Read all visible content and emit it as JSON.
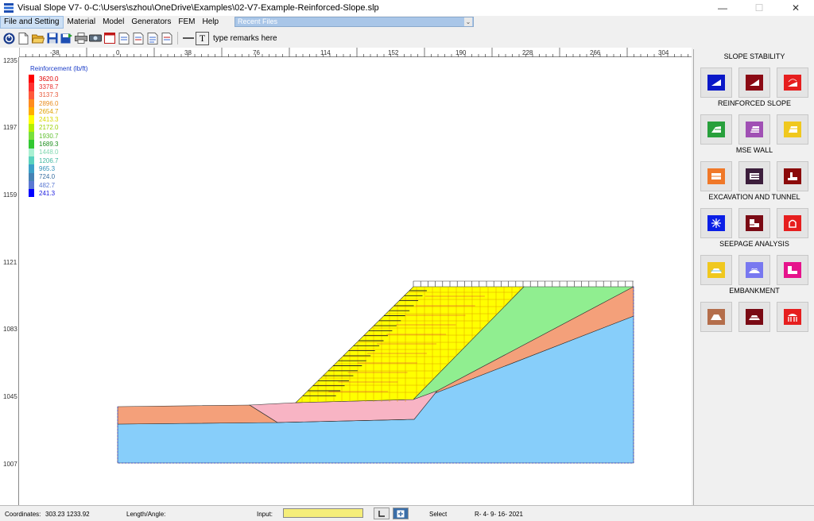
{
  "window": {
    "title": "Visual Slope V7- 0-C:\\Users\\szhou\\OneDrive\\Examples\\02-V7-Example-Reinforced-Slope.slp",
    "controls": [
      "—",
      "☐",
      "✕"
    ]
  },
  "menu": {
    "items": [
      "File and Setting",
      "Material",
      "Model",
      "Generators",
      "FEM",
      "Help"
    ],
    "recent_files": "Recent Files"
  },
  "toolbar": {
    "icons": [
      "power-icon",
      "new-file-icon",
      "open-folder-icon",
      "save-icon",
      "save-as-icon",
      "print-icon",
      "print-preview-icon",
      "window-icon",
      "report-1-icon",
      "report-2-icon",
      "report-3-icon",
      "report-4-icon"
    ],
    "text_tool": "T",
    "remarks": "type remarks here"
  },
  "rulers": {
    "top": [
      "-38",
      "0",
      "38",
      "76",
      "114",
      "152",
      "190",
      "228",
      "266",
      "304"
    ],
    "left": [
      "1235",
      "1197",
      "1159",
      "1121",
      "1083",
      "1045",
      "1007"
    ]
  },
  "legend": {
    "title": "Reinforcement (lb/ft)",
    "items": [
      {
        "value": "3620.0",
        "color": "#ff0000",
        "text_color": "#e00000"
      },
      {
        "value": "3378.7",
        "color": "#ff3030",
        "text_color": "#e83030"
      },
      {
        "value": "3137.3",
        "color": "#ff5a3c",
        "text_color": "#e85a3c"
      },
      {
        "value": "2896.0",
        "color": "#ff8c1e",
        "text_color": "#e88c1e"
      },
      {
        "value": "2654.7",
        "color": "#ffae00",
        "text_color": "#e0a000"
      },
      {
        "value": "2413.3",
        "color": "#ffff00",
        "text_color": "#d8d800"
      },
      {
        "value": "2172.0",
        "color": "#b4f000",
        "text_color": "#9ad000"
      },
      {
        "value": "1930.7",
        "color": "#78e03c",
        "text_color": "#60c030"
      },
      {
        "value": "1689.3",
        "color": "#32c832",
        "text_color": "#209020"
      },
      {
        "value": "1448.0",
        "color": "#aaf0d2",
        "text_color": "#80d8b0"
      },
      {
        "value": "1206.7",
        "color": "#5ad2be",
        "text_color": "#40b8a0"
      },
      {
        "value": "965.3",
        "color": "#3ca0c8",
        "text_color": "#3090b8"
      },
      {
        "value": "724.0",
        "color": "#4682b4",
        "text_color": "#3a6ea0"
      },
      {
        "value": "482.7",
        "color": "#5a78d2",
        "text_color": "#5a78d2"
      },
      {
        "value": "241.3",
        "color": "#0000ff",
        "text_color": "#1a1ae0"
      }
    ]
  },
  "model_colors": {
    "soil_bottom": "#87cefa",
    "soil_salmon": "#f4a07a",
    "soil_pink": "#f8b4c4",
    "soil_green": "#90ee90",
    "reinforced_fill": "#ffff00"
  },
  "panel": {
    "sections": [
      {
        "title": "SLOPE STABILITY",
        "buttons": [
          {
            "name": "slope-stability-1-button",
            "color": "#0a18c8"
          },
          {
            "name": "slope-stability-2-button",
            "color": "#8b0a14"
          },
          {
            "name": "slope-stability-3-button",
            "color": "#e61e1e"
          }
        ]
      },
      {
        "title": "REINFORCED SLOPE",
        "buttons": [
          {
            "name": "reinforced-slope-1-button",
            "color": "#28a03c"
          },
          {
            "name": "reinforced-slope-2-button",
            "color": "#a050b4"
          },
          {
            "name": "reinforced-slope-3-button",
            "color": "#f0c81e"
          }
        ]
      },
      {
        "title": "MSE WALL",
        "buttons": [
          {
            "name": "mse-wall-1-button",
            "color": "#f07828"
          },
          {
            "name": "mse-wall-2-button",
            "color": "#3c1e3c"
          },
          {
            "name": "mse-wall-3-button",
            "color": "#8b0a0a"
          }
        ]
      },
      {
        "title": "EXCAVATION AND TUNNEL",
        "buttons": [
          {
            "name": "excavation-1-button",
            "color": "#0a1ee6"
          },
          {
            "name": "excavation-2-button",
            "color": "#7a0a14"
          },
          {
            "name": "excavation-3-button",
            "color": "#e61e1e"
          }
        ]
      },
      {
        "title": "SEEPAGE ANALYSIS",
        "buttons": [
          {
            "name": "seepage-1-button",
            "color": "#f0c81e"
          },
          {
            "name": "seepage-2-button",
            "color": "#7878f0"
          },
          {
            "name": "seepage-3-button",
            "color": "#e6148c"
          }
        ]
      },
      {
        "title": "EMBANKMENT",
        "buttons": [
          {
            "name": "embankment-1-button",
            "color": "#b46e4b"
          },
          {
            "name": "embankment-2-button",
            "color": "#7a0a14"
          },
          {
            "name": "embankment-3-button",
            "color": "#e61e1e"
          }
        ]
      }
    ]
  },
  "status": {
    "coordinates_label": "Coordinates:",
    "coordinates_value": "303.23   1233.92",
    "length_angle_label": "Length/Angle:",
    "input_label": "Input:",
    "select_label": "Select",
    "date": "R- 4- 9- 16- 2021"
  }
}
